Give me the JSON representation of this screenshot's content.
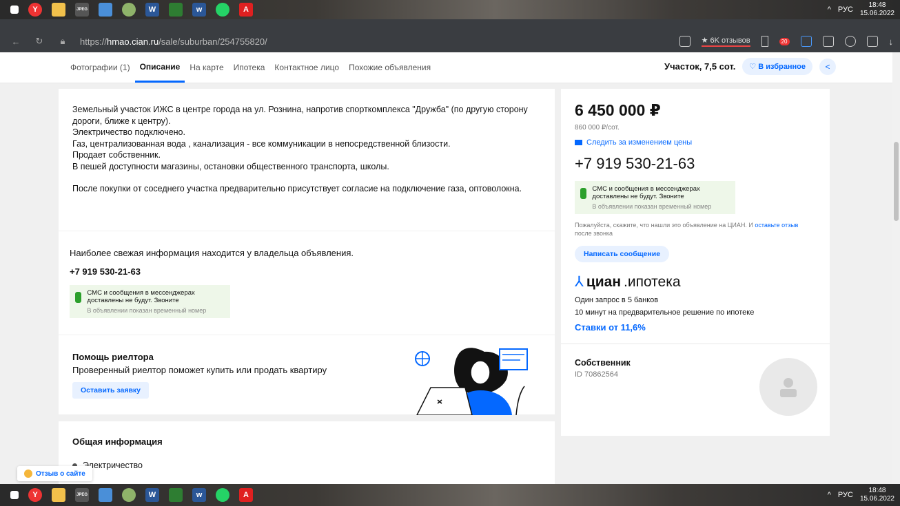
{
  "taskbar": {
    "lang": "РУС",
    "time": "18:48",
    "date": "15.06.2022"
  },
  "browser": {
    "url_prefix": "https://",
    "url_domain": "hmao.cian.ru",
    "url_path": "/sale/suburban/254755820/",
    "reviews": "★ 6K отзывов",
    "badge": "20"
  },
  "subnav": {
    "tabs": [
      "Фотографии (1)",
      "Описание",
      "На карте",
      "Ипотека",
      "Контактное лицо",
      "Похожие объявления"
    ],
    "title": "Участок, 7,5 сот.",
    "fav_label": "♡ В избранное"
  },
  "description": {
    "lines": [
      "Земельный участок ИЖС в центре города на ул. Рознина, напротив спорткомплекса \"Дружба\" (по другую сторону дороги, ближе к центру).",
      "Электричество подключено.",
      "Газ, централизованная вода , канализация - все коммуникации в непосредственной близости.",
      "Продает собственник.",
      "В пешей доступности магазины, остановки общественного транспорта, школы.",
      "",
      "После покупки от соседнего участка предварительно присутствует согласие на подключение газа, оптоволокна."
    ]
  },
  "fresh": {
    "text": "Наиболее свежая информация находится у владельца объявления.",
    "phone": "+7 919 530-21-63",
    "sms_title": "СМС и сообщения в мессенджерах доставлены не будут. Звоните",
    "sms_note": "В объявлении показан временный номер"
  },
  "help": {
    "title": "Помощь риелтора",
    "subtitle": "Проверенный риелтор поможет купить или продать квартиру",
    "button": "Оставить заявку"
  },
  "general": {
    "title": "Общая информация",
    "item": "Электричество"
  },
  "sidebar": {
    "price": "6 450 000 ₽",
    "per_sotka": "860 000 ₽/сот.",
    "watch": "Следить за изменением цены",
    "phone": "+7 919 530-21-63",
    "sms_title": "СМС и сообщения в мессенджерах доставлены не будут. Звоните",
    "sms_note": "В объявлении показан временный номер",
    "please_text": "Пожалуйста, скажите, что нашли это объявление на ЦИАН. И ",
    "please_link": "оставьте отзыв",
    "please_tail": " после звонка",
    "message_button": "Написать сообщение",
    "ipoteka_brand": "циан",
    "ipoteka_word": ".ипотека",
    "ipoteka_line1": "Один запрос в 5 банков",
    "ipoteka_line2": "10 минут на предварительное решение по ипотеке",
    "ipoteka_rate": "Ставки от 11,6%",
    "owner_title": "Собственник",
    "owner_id": "ID 70862564"
  },
  "feedback_label": "Отзыв о сайте"
}
